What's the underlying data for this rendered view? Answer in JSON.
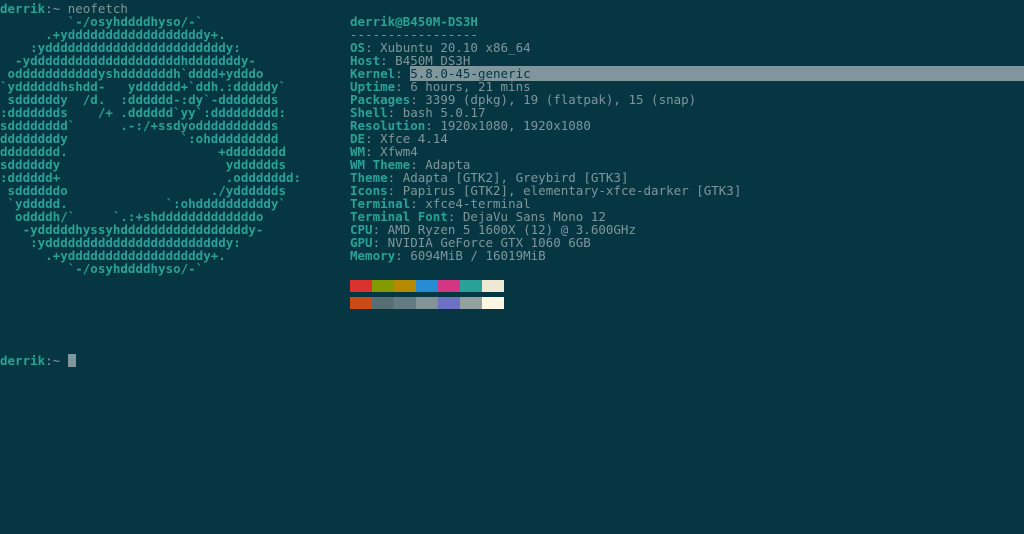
{
  "prompt": {
    "user": "derrik",
    "sep": ":~",
    "cmd": "neofetch"
  },
  "logo": [
    "         `-/osyhddddhyso/-`",
    "      .+yddddddddddddddddddy+.",
    "    :yddddddddddddddddddddddddy:",
    "  -yddddddddddddddddddddhdddddddy-",
    " odddddddddddyshdddddddh`dddd+ydddo",
    "`yddddddhshdd-   ydddddd+`ddh.:dddddy`",
    " sddddddy  /d.  :dddddd-:dy`-ddddddds",
    ":ddddddds    /+ .dddddd`yy`:ddddddddd:",
    "sdddddddd`      .-:/+ssdyodddddddddds",
    "ddddddddy               `:ohddddddddd",
    "dddddddd.                    +dddddddd",
    "sddddddy                      ydddddds",
    ":dddddd+                      .oddddddd:",
    " sddddddo                   ./ydddddds",
    " `yddddd.             `:ohddddddddddy`",
    "  oddddh/`     `.:+shdddddddddddddo",
    "   -ydddddhyssyhdddddddddddddddddy-",
    "    :yddddddddddddddddddddddddy:",
    "      .+yddddddddddddddddddy+.",
    "         `-/osyhddddhyso/-`"
  ],
  "title": "derrik@B450M-DS3H",
  "dashes": "-----------------",
  "fields": [
    {
      "label": "OS",
      "value": "Xubuntu 20.10 x86_64",
      "sel": false
    },
    {
      "label": "Host",
      "value": "B450M DS3H",
      "sel": false
    },
    {
      "label": "Kernel",
      "value": "5.8.0-45-generic",
      "sel": true
    },
    {
      "label": "Uptime",
      "value": "6 hours, 21 mins",
      "sel": false
    },
    {
      "label": "Packages",
      "value": "3399 (dpkg), 19 (flatpak), 15 (snap)",
      "sel": false
    },
    {
      "label": "Shell",
      "value": "bash 5.0.17",
      "sel": false
    },
    {
      "label": "Resolution",
      "value": "1920x1080, 1920x1080",
      "sel": false
    },
    {
      "label": "DE",
      "value": "Xfce 4.14",
      "sel": false
    },
    {
      "label": "WM",
      "value": "Xfwm4",
      "sel": false
    },
    {
      "label": "WM Theme",
      "value": "Adapta",
      "sel": false
    },
    {
      "label": "Theme",
      "value": "Adapta [GTK2], Greybird [GTK3]",
      "sel": false
    },
    {
      "label": "Icons",
      "value": "Papirus [GTK2], elementary-xfce-darker [GTK3]",
      "sel": false
    },
    {
      "label": "Terminal",
      "value": "xfce4-terminal",
      "sel": false
    },
    {
      "label": "Terminal Font",
      "value": "DejaVu Sans Mono 12",
      "sel": false
    },
    {
      "label": "CPU",
      "value": "AMD Ryzen 5 1600X (12) @ 3.600GHz",
      "sel": false
    },
    {
      "label": "GPU",
      "value": "NVIDIA GeForce GTX 1060 6GB",
      "sel": false
    },
    {
      "label": "Memory",
      "value": "6094MiB / 16019MiB",
      "sel": false
    }
  ],
  "swatch_colors": [
    [
      "#dc322f",
      "#859900",
      "#b58900",
      "#268bd2",
      "#d33682",
      "#2aa198",
      "#eee8d5"
    ],
    [
      "#cb4b16",
      "#586e75",
      "#657b83",
      "#839496",
      "#6c71c4",
      "#93a1a1",
      "#fdf6e3"
    ]
  ]
}
